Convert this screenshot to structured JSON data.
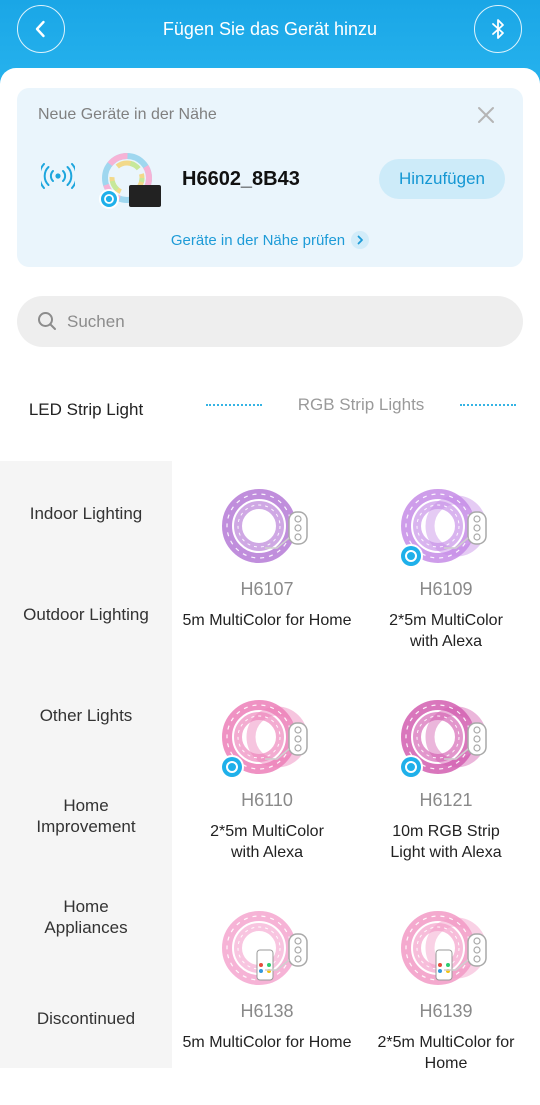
{
  "header": {
    "title": "Fügen Sie das Gerät hinzu",
    "back_icon": "chevron-left-icon",
    "bluetooth_icon": "bluetooth-icon"
  },
  "nearby": {
    "title": "Neue Geräte in der Nähe",
    "device_name": "H6602_8B43",
    "add_label": "Hinzufügen",
    "check_label": "Geräte in der Nähe prüfen"
  },
  "search": {
    "placeholder": "Suchen"
  },
  "category": {
    "main": "LED Strip Light",
    "sub": "RGB Strip Lights"
  },
  "sidebar": {
    "items": [
      {
        "label": "Indoor Lighting"
      },
      {
        "label": "Outdoor Lighting"
      },
      {
        "label": "Other Lights"
      },
      {
        "label": "Home Improvement"
      },
      {
        "label": "Home Appliances"
      },
      {
        "label": "Discontinued"
      }
    ]
  },
  "products": [
    {
      "code": "H6107",
      "name": "5m MultiColor for Home",
      "color": "#b57ad6",
      "alexa": false,
      "remote": false
    },
    {
      "code": "H6109",
      "name": "2*5m MultiColor with Alexa",
      "color": "#c58ce6",
      "alexa": true,
      "remote": false
    },
    {
      "code": "H6110",
      "name": "2*5m MultiColor with Alexa",
      "color": "#ec7fb9",
      "alexa": true,
      "remote": false
    },
    {
      "code": "H6121",
      "name": "10m RGB Strip Light with Alexa",
      "color": "#d25eb0",
      "alexa": true,
      "remote": false
    },
    {
      "code": "H6138",
      "name": "5m MultiColor for Home",
      "color": "#f4a6cf",
      "alexa": false,
      "remote": true
    },
    {
      "code": "H6139",
      "name": "2*5m MultiColor for Home",
      "color": "#f29ac6",
      "alexa": false,
      "remote": true
    }
  ],
  "colors": {
    "accent": "#1e9bd7",
    "header": "#1aa6e6",
    "alexa": "#1fb0ea"
  }
}
